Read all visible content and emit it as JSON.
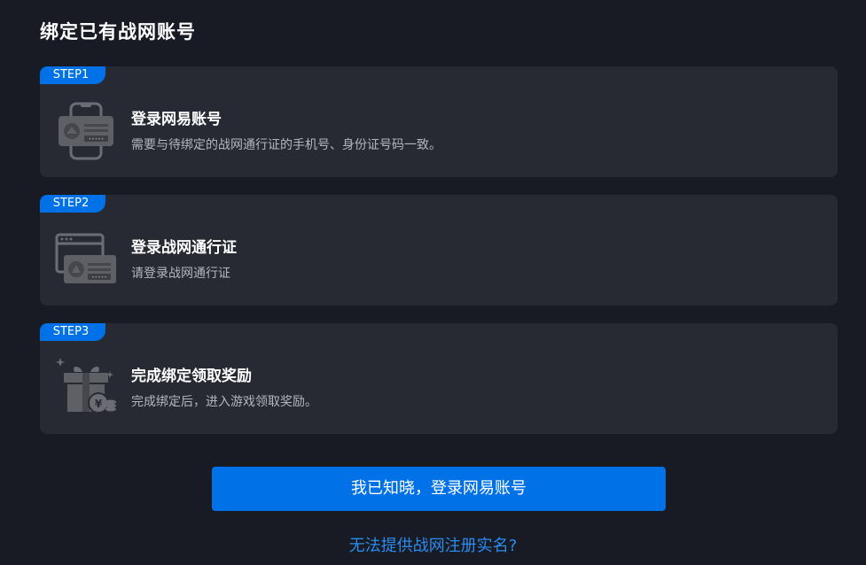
{
  "page": {
    "title": "绑定已有战网账号"
  },
  "steps": [
    {
      "badge": "STEP1",
      "title": "登录网易账号",
      "description": "需要与待绑定的战网通行证的手机号、身份证号码一致。",
      "icon": "id-card-phone-icon"
    },
    {
      "badge": "STEP2",
      "title": "登录战网通行证",
      "description": "请登录战网通行证",
      "icon": "browser-card-icon"
    },
    {
      "badge": "STEP3",
      "title": "完成绑定领取奖励",
      "description": "完成绑定后，进入游戏领取奖励。",
      "icon": "gift-reward-icon"
    }
  ],
  "actions": {
    "confirm_label": "我已知晓，登录网易账号",
    "help_link": "无法提供战网注册实名?"
  },
  "colors": {
    "background": "#181b23",
    "card": "#272a33",
    "accent": "#0071e6",
    "link": "#2a8cf0"
  }
}
